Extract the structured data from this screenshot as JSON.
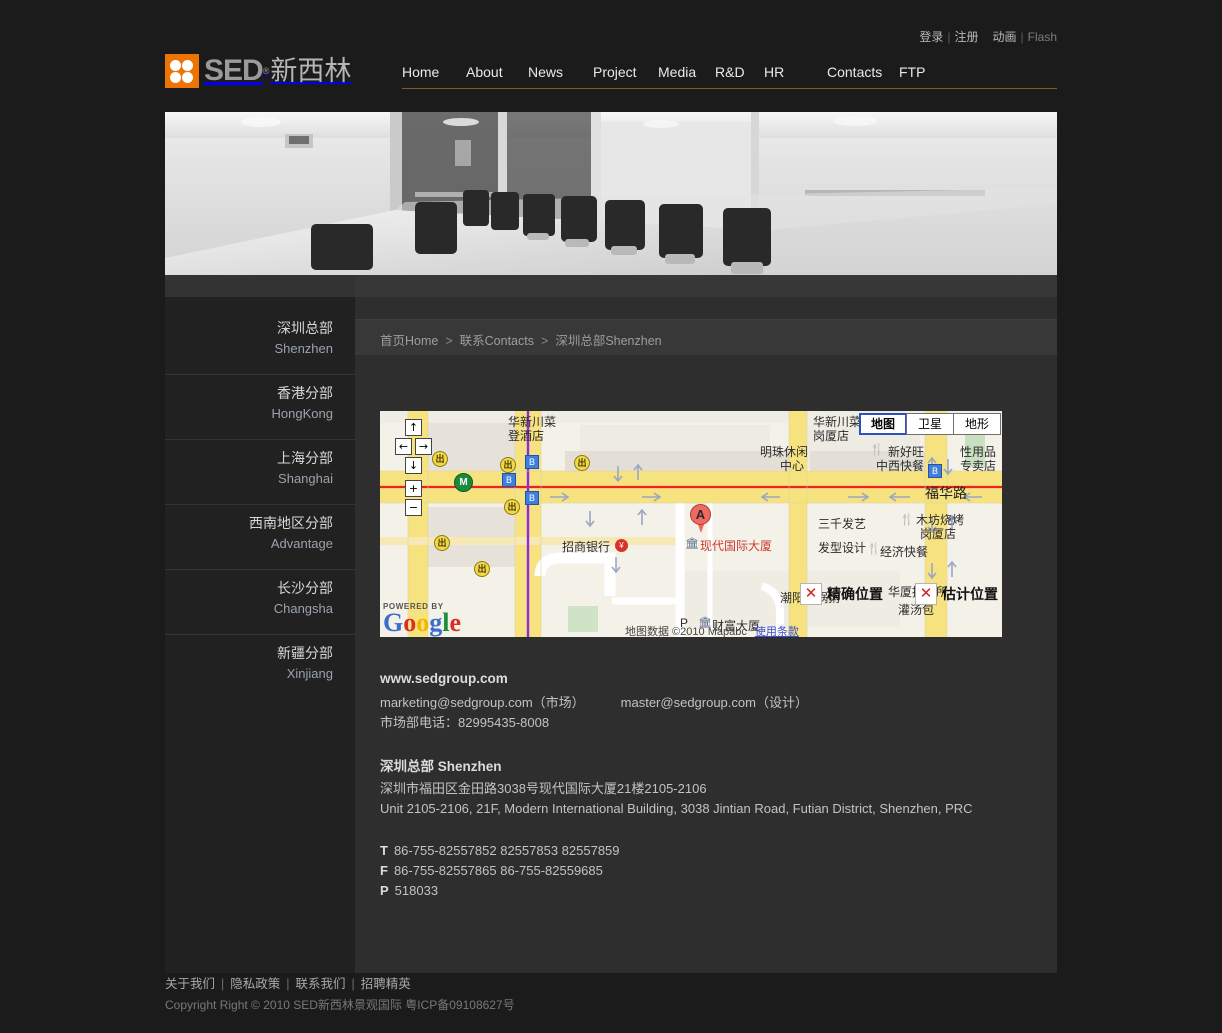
{
  "utility": {
    "login": "登录",
    "register": "注册",
    "animation": "动画",
    "flash": "Flash",
    "separator": "|"
  },
  "brand": {
    "mark": "sed-clover-logo",
    "name": "SED",
    "registered": "®",
    "name_cn": "新西林"
  },
  "nav": {
    "items": [
      {
        "label": "Home"
      },
      {
        "label": "About"
      },
      {
        "label": "News"
      },
      {
        "label": "Project"
      },
      {
        "label": "Media"
      },
      {
        "label": "R&D"
      },
      {
        "label": "HR"
      },
      {
        "label": "Contacts"
      },
      {
        "label": "FTP"
      }
    ]
  },
  "banner": {
    "alt": "conference-room-photo-black-and-white"
  },
  "sidebar": {
    "items": [
      {
        "cn": "深圳总部",
        "en": "Shenzhen"
      },
      {
        "cn": "香港分部",
        "en": "HongKong"
      },
      {
        "cn": "上海分部",
        "en": "Shanghai"
      },
      {
        "cn": "西南地区分部",
        "en": "Advantage"
      },
      {
        "cn": "长沙分部",
        "en": "Changsha"
      },
      {
        "cn": "新疆分部",
        "en": "Xinjiang"
      }
    ]
  },
  "breadcrumb": {
    "home": "首页Home",
    "contacts": "联系Contacts",
    "current": "深圳总部Shenzhen",
    "arrow": ">"
  },
  "map": {
    "controls": {
      "pan_up": "↑",
      "pan_left": "←",
      "pan_right": "→",
      "pan_down": "↓",
      "zoom_in": "+",
      "zoom_out": "−"
    },
    "types": [
      {
        "label": "地图",
        "selected": true
      },
      {
        "label": "卫星",
        "selected": false
      },
      {
        "label": "地形",
        "selected": false
      }
    ],
    "marker": {
      "letter": "A",
      "label": "现代国际大厦"
    },
    "labels": [
      {
        "text": "登酒店"
      },
      {
        "text": "华新川菜"
      },
      {
        "text": "岗厦店"
      },
      {
        "text": "明珠休闲"
      },
      {
        "text": "中心"
      },
      {
        "text": "新好旺"
      },
      {
        "text": "中西快餐"
      },
      {
        "text": "性用品"
      },
      {
        "text": "专卖店"
      },
      {
        "text": "福华路"
      },
      {
        "text": "招商银行"
      },
      {
        "text": "三千发艺"
      },
      {
        "text": "发型设计"
      },
      {
        "text": "木坊烧烤"
      },
      {
        "text": "岗厦店"
      },
      {
        "text": "经济快餐"
      },
      {
        "text": "潮阳砂锅粥"
      },
      {
        "text": "灌汤包"
      },
      {
        "text": "华厦招待所"
      },
      {
        "text": "财富大厦"
      }
    ],
    "legend": [
      {
        "icon": "red-x",
        "label": "精确位置"
      },
      {
        "icon": "red-x",
        "label": "估计位置"
      }
    ],
    "powered_by": "POWERED BY",
    "provider": "Google",
    "attribution": "地图数据 ©2010 Mapabc",
    "terms": "使用条款"
  },
  "contact": {
    "website": "www.sedgroup.com",
    "email_marketing": "marketing@sedgroup.com（市场）",
    "email_master": "master@sedgroup.com（设计）",
    "marketing_phone": "市场部电话：82995435-8008",
    "office_title": "深圳总部 Shenzhen",
    "address_cn": "深圳市福田区金田路3038号现代国际大厦21楼2105-2106",
    "address_en": "Unit 2105-2106, 21F, Modern International Building, 3038 Jintian Road, Futian District, Shenzhen, PRC",
    "tel_prefix": "T",
    "tel": "86-755-82557852  82557853  82557859",
    "fax_prefix": "F",
    "fax": "86-755-82557865  86-755-82559685",
    "post_prefix": "P",
    "post": "518033"
  },
  "footer": {
    "links": [
      {
        "label": "关于我们"
      },
      {
        "label": "隐私政策"
      },
      {
        "label": "联系我们"
      },
      {
        "label": "招聘精英"
      }
    ],
    "separator": "|",
    "copyright": "Copyright Right © 2010 SED新西林景观国际 粤ICP备09108627号"
  },
  "colors": {
    "accent": "#ec7404",
    "nav_underline": "#8a5a1c",
    "page_bg": "#1b1b1b",
    "sidebar_bg": "#212121",
    "content_bg": "#2e2e2e"
  }
}
